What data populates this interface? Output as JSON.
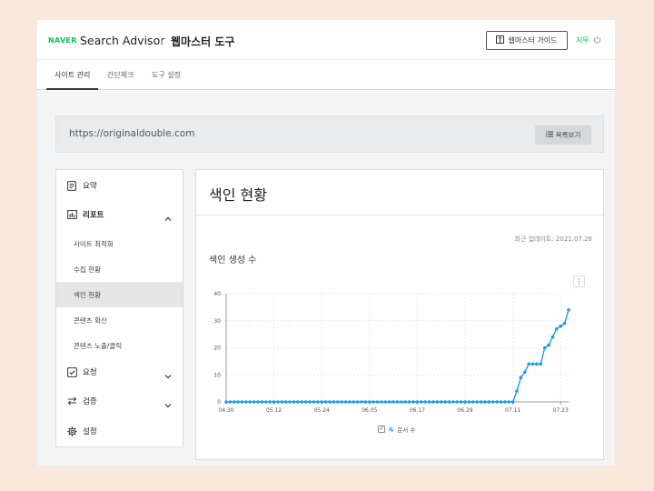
{
  "header": {
    "logo": "NAVER",
    "brand": "Search Advisor",
    "subbrand": "웹마스터 도구",
    "guide_button": "웹마스터 가이드",
    "user": "지뚜"
  },
  "tabs": [
    {
      "label": "사이트 관리",
      "active": true
    },
    {
      "label": "간단체크",
      "active": false
    },
    {
      "label": "도구 설정",
      "active": false
    }
  ],
  "site": {
    "url": "https://originaldouble.com",
    "list_button": "목록보기"
  },
  "sidebar": {
    "items": [
      {
        "label": "요약",
        "icon": "document-icon"
      },
      {
        "label": "리포트",
        "icon": "chart-icon",
        "expanded": true
      },
      {
        "label": "요청",
        "icon": "checkbox-icon"
      },
      {
        "label": "검증",
        "icon": "arrows-icon"
      },
      {
        "label": "설정",
        "icon": "gear-icon"
      }
    ],
    "report_sub": [
      {
        "label": "사이트 최적화"
      },
      {
        "label": "수집 현황"
      },
      {
        "label": "색인 현황",
        "active": true
      },
      {
        "label": "콘텐츠 확산"
      },
      {
        "label": "콘텐츠 노출/클릭"
      }
    ]
  },
  "content": {
    "title": "색인 현황",
    "updated": "최근 업데이트: 2021.07.26",
    "chart_title": "색인 생성 수",
    "menu_icon": "⋮"
  },
  "colors": {
    "accent": "#03c75a",
    "line": "#1e9cf0"
  },
  "chart_data": {
    "type": "line",
    "title": "색인 생성 수",
    "xlabel": "",
    "ylabel": "",
    "ylim": [
      0,
      40
    ],
    "yticks": [
      0,
      10,
      20,
      30,
      40
    ],
    "x_tick_labels": [
      "04.30",
      "05.12",
      "05.24",
      "06.05",
      "06.17",
      "06.29",
      "07.11",
      "07.23"
    ],
    "x_start": "04.30",
    "x_end": "07.26",
    "grid": true,
    "legend": "bottom",
    "series": [
      {
        "name": "문서 수",
        "values": [
          0,
          0,
          0,
          0,
          0,
          0,
          0,
          0,
          0,
          0,
          0,
          0,
          0,
          0,
          0,
          0,
          0,
          0,
          0,
          0,
          0,
          0,
          0,
          0,
          0,
          0,
          0,
          0,
          0,
          0,
          0,
          0,
          0,
          0,
          0,
          0,
          0,
          0,
          0,
          0,
          0,
          0,
          0,
          0,
          0,
          0,
          0,
          0,
          0,
          0,
          0,
          0,
          0,
          0,
          0,
          0,
          0,
          0,
          0,
          0,
          0,
          0,
          0,
          0,
          0,
          0,
          0,
          0,
          0,
          0,
          0,
          0,
          0,
          4,
          9,
          11,
          14,
          14,
          14,
          14,
          20,
          21,
          24,
          27,
          28,
          29,
          34
        ]
      }
    ]
  }
}
